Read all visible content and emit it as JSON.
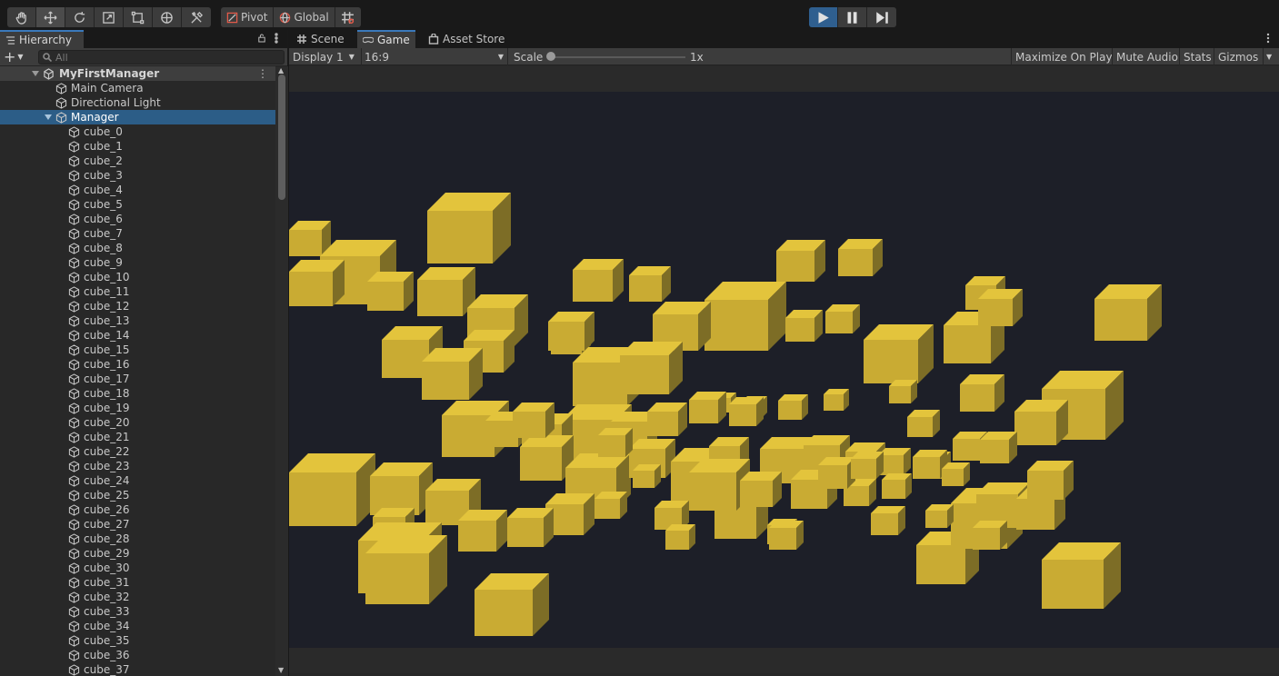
{
  "toolbar": {
    "tools": [
      "hand-tool",
      "move-tool",
      "rotate-tool",
      "scale-tool",
      "rect-tool",
      "transform-tool",
      "custom-tool"
    ],
    "pivot_label": "Pivot",
    "global_label": "Global",
    "play_state": "playing"
  },
  "hierarchy": {
    "tab_label": "Hierarchy",
    "add_symbol": "+",
    "search_placeholder": "All",
    "scene_name": "MyFirstManager",
    "top_items": [
      "Main Camera",
      "Directional Light"
    ],
    "selected_item": "Manager",
    "children": [
      "cube_0",
      "cube_1",
      "cube_2",
      "cube_3",
      "cube_4",
      "cube_5",
      "cube_6",
      "cube_7",
      "cube_8",
      "cube_9",
      "cube_10",
      "cube_11",
      "cube_12",
      "cube_13",
      "cube_14",
      "cube_15",
      "cube_16",
      "cube_17",
      "cube_18",
      "cube_19",
      "cube_20",
      "cube_21",
      "cube_22",
      "cube_23",
      "cube_24",
      "cube_25",
      "cube_26",
      "cube_27",
      "cube_28",
      "cube_29",
      "cube_30",
      "cube_31",
      "cube_32",
      "cube_33",
      "cube_34",
      "cube_35",
      "cube_36",
      "cube_37"
    ]
  },
  "game": {
    "tabs": {
      "scene": "Scene",
      "game": "Game",
      "asset_store": "Asset Store"
    },
    "display": "Display 1",
    "aspect": "16:9",
    "scale_label": "Scale",
    "scale_value": "1x",
    "maximize": "Maximize On Play",
    "mute": "Mute Audio",
    "stats": "Stats",
    "gizmos": "Gizmos"
  },
  "colors": {
    "accent": "#3a79bb",
    "selection": "#2c5d87",
    "cube_top": "#e3c43c",
    "cube_front": "#c9ab33",
    "cube_side": "#7d6d26",
    "viewport_bg": "#1d1f28"
  }
}
